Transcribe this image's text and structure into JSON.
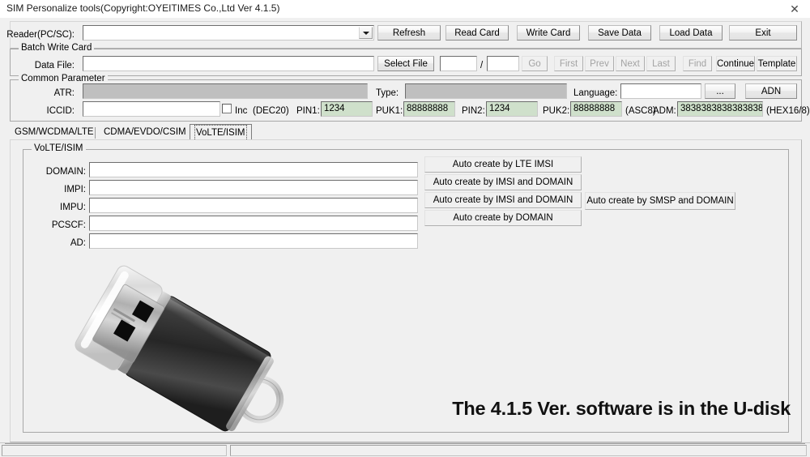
{
  "window": {
    "title": "SIM Personalize tools(Copyright:OYEITIMES Co.,Ltd Ver 4.1.5)",
    "close_icon": "close-icon",
    "close_glyph": "✕"
  },
  "reader_row": {
    "label": "Reader(PC/SC):",
    "combo_value": "",
    "combo_placeholder": "",
    "dropdown_icon": "chevron-down-icon",
    "buttons": [
      {
        "label": "Refresh",
        "disabled": false
      },
      {
        "label": "Read Card",
        "disabled": false
      },
      {
        "label": "Write Card",
        "disabled": false
      },
      {
        "label": "Save Data",
        "disabled": false
      },
      {
        "label": "Load Data",
        "disabled": false
      },
      {
        "label": "Exit",
        "disabled": false
      }
    ]
  },
  "batch_write_card": {
    "group_label": "Batch Write Card",
    "data_file_label": "Data File:",
    "data_file_value": "",
    "select_file_label": "Select File",
    "index_current": "",
    "index_separator": "/",
    "index_total": "",
    "nav_buttons": [
      {
        "label": "Go",
        "disabled": true
      },
      {
        "label": "First",
        "disabled": true
      },
      {
        "label": "Prev",
        "disabled": true
      },
      {
        "label": "Next",
        "disabled": true
      },
      {
        "label": "Last",
        "disabled": true
      },
      {
        "label": "Find",
        "disabled": true
      },
      {
        "label": "Continue",
        "disabled": false
      },
      {
        "label": "Template",
        "disabled": false
      }
    ]
  },
  "common_parameter": {
    "group_label": "Common Parameter",
    "atr_label": "ATR:",
    "atr_value": "",
    "type_label": "Type:",
    "type_value": "",
    "language_label": "Language:",
    "language_value": "",
    "language_browse_label": "...",
    "adn_label": "ADN",
    "iccid_label": "ICCID:",
    "iccid_value": "",
    "inc_label": "Inc",
    "inc_hint": "(DEC20)",
    "inc_checked": false,
    "pin1_label": "PIN1:",
    "pin1_value": "1234",
    "puk1_label": "PUK1:",
    "puk1_value": "88888888",
    "pin2_label": "PIN2:",
    "pin2_value": "1234",
    "puk2_label": "PUK2:",
    "puk2_value": "88888888",
    "asc8_hint": "(ASC8)",
    "adm_label": "ADM:",
    "adm_value": "3838383838383838",
    "adm_hint": "(HEX16/8)"
  },
  "tabs": [
    {
      "label": "GSM/WCDMA/LTE",
      "selected": false
    },
    {
      "label": "CDMA/EVDO/CSIM",
      "selected": false
    },
    {
      "label": "VoLTE/ISIM",
      "selected": true
    }
  ],
  "volte_panel": {
    "group_label": "VoLTE/ISIM",
    "fields": [
      {
        "label": "DOMAIN:",
        "value": ""
      },
      {
        "label": "IMPI:",
        "value": ""
      },
      {
        "label": "IMPU:",
        "value": ""
      },
      {
        "label": "PCSCF:",
        "value": ""
      },
      {
        "label": "AD:",
        "value": ""
      }
    ],
    "auto_buttons": [
      {
        "label": "Auto create by LTE IMSI"
      },
      {
        "label": "Auto create by IMSI and DOMAIN"
      },
      {
        "label": "Auto create by IMSI and DOMAIN"
      },
      {
        "label": "Auto create by DOMAIN"
      }
    ],
    "smsp_button": {
      "label": "Auto create by SMSP and DOMAIN"
    },
    "note": "The 4.1.5 Ver. software is in the U-disk",
    "usb_image_name": "usb-flash-drive-image"
  },
  "statusbar": {
    "cells": [
      "",
      ""
    ]
  },
  "colors": {
    "window_bg": "#f0f0f0",
    "field_green": "#cfe0cb",
    "field_gray": "#bfbfbf",
    "border": "#848484",
    "disabled_text": "#a3a3a3"
  }
}
